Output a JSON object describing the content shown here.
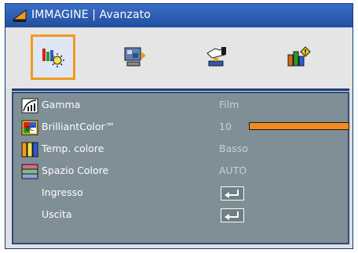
{
  "window": {
    "title": "IMMAGINE | Avanzato",
    "icon": "image-menu-icon"
  },
  "tabs": [
    {
      "id": "image",
      "icon": "image-settings-icon",
      "selected": true
    },
    {
      "id": "display",
      "icon": "display-projector-icon",
      "selected": false
    },
    {
      "id": "setup",
      "icon": "setup-hand-icon",
      "selected": false
    },
    {
      "id": "options",
      "icon": "options-info-icon",
      "selected": false
    }
  ],
  "menu": [
    {
      "label": "Gamma",
      "value": "Film",
      "icon": "gamma-icon"
    },
    {
      "label": "BrilliantColor™",
      "value": "10",
      "icon": "brilliantcolor-icon",
      "slider_fraction": 1.0
    },
    {
      "label": "Temp. colore",
      "value": "Basso",
      "icon": "color-temp-icon"
    },
    {
      "label": "Spazio Colore",
      "value": "AUTO",
      "icon": "color-space-icon"
    },
    {
      "label": "Ingresso",
      "icon": "enter-icon"
    },
    {
      "label": "Uscita",
      "icon": "enter-icon"
    }
  ],
  "colors": {
    "title_bar": "#2b5cb0",
    "selected_border": "#f39a1e",
    "content_bg": "#7f8f95",
    "slider": "#f38b1c",
    "value_text": "#c3d0df"
  }
}
